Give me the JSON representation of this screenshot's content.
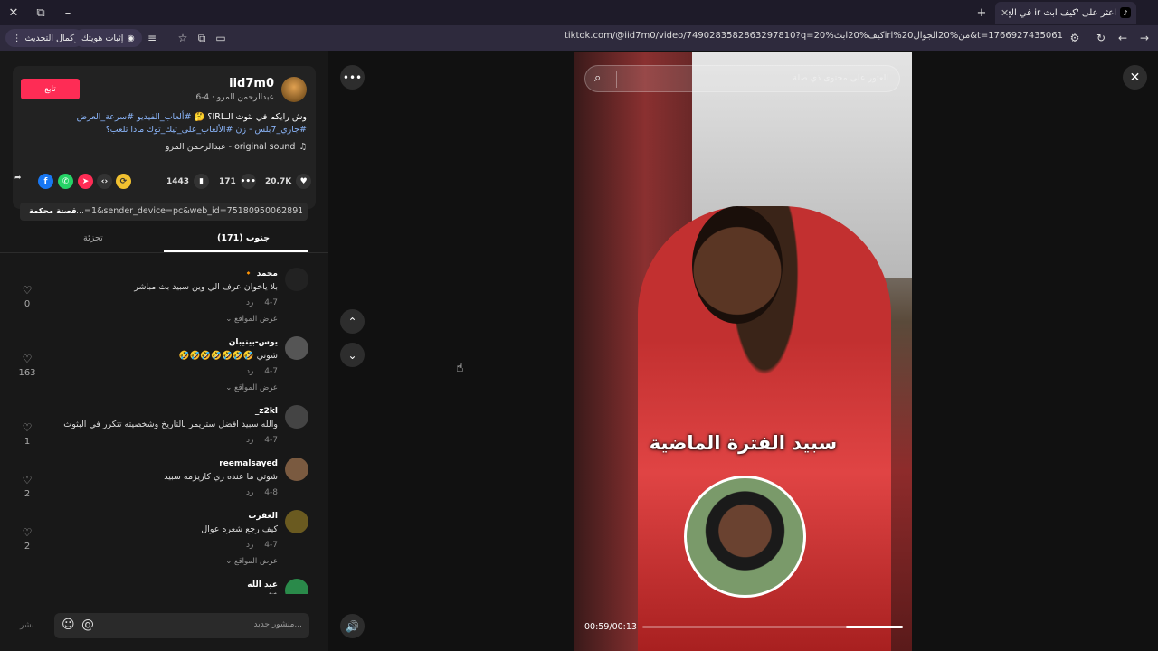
{
  "browser": {
    "tab_title": "اعثر على 'كيف ابث ir في الج",
    "tab_close": "✕",
    "new_tab": "+",
    "window_close": "✕",
    "window_restore": "⧉",
    "window_min": "–",
    "url": "tiktok.com/@iid7m0/video/7490283582863297810?q=كيف%20ابث%20irl%20من%20الجوال&t=1766927435061",
    "update_label": "إكمال التحديث",
    "identity_label": "إثبات هويتك"
  },
  "post": {
    "username": "iid7m0",
    "subname": "عبدالرحمن المرو · 4-6",
    "follow_label": "تابع",
    "description": "وش رايكم في بثوث الـIRL؟ 🤔 ",
    "tags": "#ألعاب_الفيديو #سرعة_العرض #جاري_7بلس - زن #الألعاب_على_تيك_توك ماذا تلعب؟",
    "music": "original sound - عبدالرحمن المرو",
    "likes": "20.7K",
    "comments_count": "171",
    "saves": "1443",
    "link": "...=1&sender_device=pc&web_id=7518095006289102354",
    "copy_label": "قصتة محكمة"
  },
  "tabs": {
    "comments": "جنوب (171)",
    "other": "تجزئة"
  },
  "comments": [
    {
      "name": "محمد 🔸",
      "text": "بلا ياخوان عرف الي وين سبيد بث مباشر",
      "date": "4-7",
      "reply": "رد",
      "view": "عرض المواقع",
      "likes": "0",
      "color": "#222"
    },
    {
      "name": "يوس-بينيبان",
      "text": "شوتي 🤣🤣🤣🤣🤣🤣🤣",
      "date": "4-7",
      "reply": "رد",
      "view": "عرض المواقع",
      "likes": "163",
      "color": "#555"
    },
    {
      "name": "z2kl_",
      "text": "والله سبيد افضل ستريمر بالتاريخ وشخصيته تتكرر في البثوث",
      "date": "4-7",
      "reply": "رد",
      "view": "",
      "likes": "1",
      "color": "#444"
    },
    {
      "name": "reemalsayed",
      "text": "شوتي ما عنده زي كاريزمه سبيد",
      "date": "4-8",
      "reply": "رد",
      "view": "",
      "likes": "2",
      "color": "#7a5a40"
    },
    {
      "name": "العقرب",
      "text": "كيف رجع شعره عوال",
      "date": "4-7",
      "reply": "رد",
      "view": "عرض المواقع",
      "likes": "2",
      "color": "#6a5a20"
    },
    {
      "name": "عبد الله",
      "text": "😹",
      "date": "",
      "reply": "",
      "view": "",
      "likes": "",
      "color": "#2a8a4a"
    }
  ],
  "input": {
    "placeholder": "...منشور جديد",
    "post_label": "نشر"
  },
  "video": {
    "search_placeholder": "العثور على محتوى ذي صلة",
    "caption": "سبيد الفترة الماضية",
    "time": "00:59/00:13",
    "progress": 0.22
  }
}
